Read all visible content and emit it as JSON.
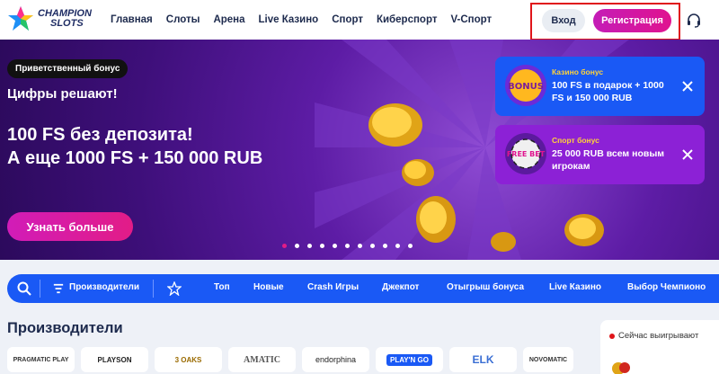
{
  "header": {
    "logo_line1": "CHAMPION",
    "logo_line2": "SLOTS",
    "nav": [
      "Главная",
      "Слоты",
      "Арена",
      "Live Казино",
      "Спорт",
      "Киберспорт",
      "V-Спорт"
    ],
    "login_label": "Вход",
    "register_label": "Регистрация",
    "support_icon": "headset-icon"
  },
  "hero": {
    "badge": "Приветственный бонус",
    "subtitle": "Цифры решают!",
    "title_line1": "100 FS без депозита!",
    "title_line2": "А еще 1000 FS + 150 000 RUB",
    "cta_label": "Узнать больше",
    "slides_total": 11,
    "active_slide": 1
  },
  "cards": [
    {
      "label": "Казино бонус",
      "text": "100 FS в подарок + 1000 FS и 150 000 RUB",
      "badge_text": "BONUS"
    },
    {
      "label": "Спорт бонус",
      "text": "25 000 RUB всем новым игрокам",
      "badge_text": "FREE BET"
    }
  ],
  "filter_bar": {
    "providers_label": "Производители",
    "tabs": [
      "Топ",
      "Новые",
      "Crash Игры",
      "Джекпот",
      "Отыгрыш бонуса",
      "Live Казино",
      "Выбор Чемпионо"
    ]
  },
  "providers": {
    "title": "Производители",
    "items": [
      "PRAGMATIC PLAY",
      "PLAYSON",
      "3 OAKS",
      "AMATIC",
      "endorphina",
      "PLAY'N GO",
      "ELK",
      "NOVOMATIC"
    ]
  },
  "winners": {
    "label": "Сейчас выигрывают"
  },
  "colors": {
    "accent_blue": "#1a59f5",
    "accent_pink": "#e0138f",
    "hero_purple": "#5d1ca5",
    "sport_card": "#8c21d6"
  }
}
